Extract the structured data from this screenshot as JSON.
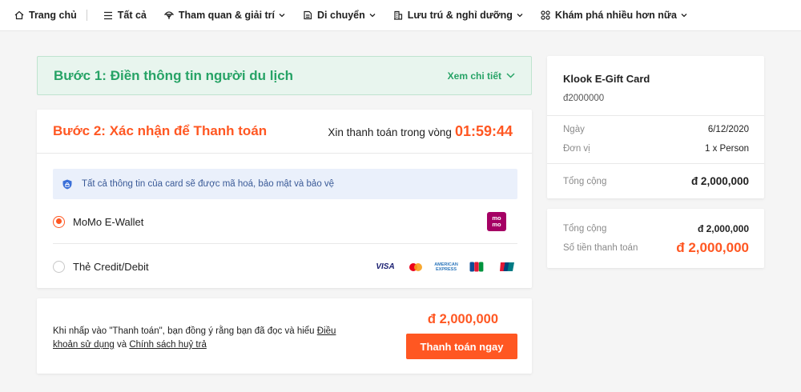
{
  "nav": {
    "home": "Trang chủ",
    "all": "Tất cả",
    "tours": "Tham quan & giải trí",
    "transport": "Di chuyển",
    "stay": "Lưu trú & nghỉ dưỡng",
    "explore": "Khám phá nhiều hơn nữa"
  },
  "step1": {
    "title": "Bước 1: Điền thông tin người du lịch",
    "details_link": "Xem chi tiết"
  },
  "step2": {
    "title": "Bước 2: Xác nhận để Thanh toán",
    "timer_label": "Xin thanh toán trong vòng",
    "timer_value": "01:59:44",
    "secure_note": "Tất cả thông tin của card sẽ được mã hoá, bảo mật và bảo vệ",
    "options": [
      {
        "label": "MoMo E-Wallet",
        "selected": true,
        "logo_top": "mo",
        "logo_bottom": "mo"
      },
      {
        "label": "Thẻ Credit/Debit",
        "selected": false
      }
    ],
    "card_brands": {
      "visa": "VISA",
      "amex_top": "AMERICAN",
      "amex_bottom": "EXPRESS"
    }
  },
  "bottom": {
    "terms_prefix": "Khi nhấp vào \"Thanh toán\", bạn đồng ý rằng bạn đã đọc và hiểu ",
    "terms_link": "Điều khoản sử dụng",
    "terms_mid": " và ",
    "cancel_link": "Chính sách huỷ trả",
    "price": "đ 2,000,000",
    "pay_button": "Thanh toán ngay"
  },
  "summary": {
    "product": "Klook E-Gift Card",
    "amount": "đ2000000",
    "date_label": "Ngày",
    "date_value": "6/12/2020",
    "unit_label": "Đơn vị",
    "unit_value": "1 x Person",
    "total_label": "Tổng cộng",
    "total_value": "đ 2,000,000"
  },
  "totals": {
    "total_label": "Tổng cộng",
    "total_value": "đ 2,000,000",
    "pay_label": "Số tiền thanh toán",
    "pay_value": "đ 2,000,000"
  },
  "colors": {
    "accent": "#ff5722",
    "success": "#27a366",
    "momo": "#a50064",
    "info_bg": "#eaf0fb"
  }
}
